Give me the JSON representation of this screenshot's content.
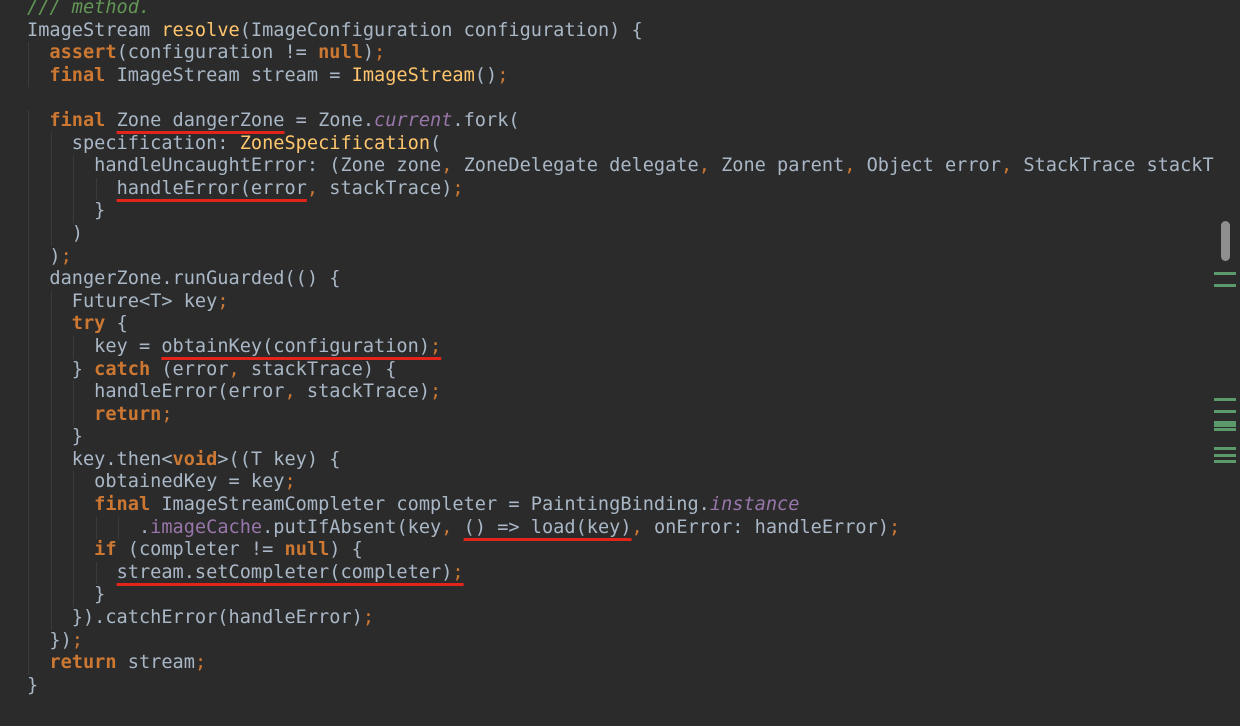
{
  "editor": {
    "colors": {
      "background": "#2b2b2b",
      "plain": "#a9b7c6",
      "keyword": "#cc7832",
      "function": "#ffc66d",
      "comment": "#629755",
      "field": "#9876aa",
      "annotation_underline": "#e3241b",
      "gutter_marker": "#5b9a6b"
    },
    "lines": [
      {
        "indent": 0,
        "tokens": [
          {
            "t": "/// method.",
            "c": "cmt"
          }
        ]
      },
      {
        "indent": 0,
        "tokens": [
          {
            "t": "ImageStream ",
            "c": "plain"
          },
          {
            "t": "resolve",
            "c": "fn"
          },
          {
            "t": "(ImageConfiguration configuration) {",
            "c": "plain"
          }
        ]
      },
      {
        "indent": 1,
        "tokens": [
          {
            "t": "assert",
            "c": "kw"
          },
          {
            "t": "(configuration != ",
            "c": "plain"
          },
          {
            "t": "null",
            "c": "kw"
          },
          {
            "t": ")",
            "c": "plain"
          },
          {
            "t": ";",
            "c": "sym"
          }
        ]
      },
      {
        "indent": 1,
        "tokens": [
          {
            "t": "final ",
            "c": "kw"
          },
          {
            "t": "ImageStream stream = ",
            "c": "plain"
          },
          {
            "t": "ImageStream",
            "c": "fn"
          },
          {
            "t": "()",
            "c": "plain"
          },
          {
            "t": ";",
            "c": "sym"
          }
        ]
      },
      {
        "indent": 0,
        "tokens": []
      },
      {
        "indent": 1,
        "tokens": [
          {
            "t": "final ",
            "c": "kw"
          },
          {
            "t": "Zone dangerZone",
            "c": "plain",
            "u": true
          },
          {
            "t": " = Zone.",
            "c": "plain"
          },
          {
            "t": "current",
            "c": "ital"
          },
          {
            "t": ".fork(",
            "c": "plain"
          }
        ]
      },
      {
        "indent": 2,
        "tokens": [
          {
            "t": "specification: ",
            "c": "plain"
          },
          {
            "t": "ZoneSpecification",
            "c": "fn"
          },
          {
            "t": "(",
            "c": "plain"
          }
        ]
      },
      {
        "indent": 3,
        "tokens": [
          {
            "t": "handleUncaughtError: (Zone zone",
            "c": "plain"
          },
          {
            "t": ", ",
            "c": "sym"
          },
          {
            "t": "ZoneDelegate delegate",
            "c": "plain"
          },
          {
            "t": ", ",
            "c": "sym"
          },
          {
            "t": "Zone parent",
            "c": "plain"
          },
          {
            "t": ", ",
            "c": "sym"
          },
          {
            "t": "Object error",
            "c": "plain"
          },
          {
            "t": ", ",
            "c": "sym"
          },
          {
            "t": "StackTrace stackTr",
            "c": "plain"
          }
        ]
      },
      {
        "indent": 4,
        "tokens": [
          {
            "t": "handleError(error",
            "c": "plain",
            "u": true
          },
          {
            "t": ", ",
            "c": "sym"
          },
          {
            "t": "stackTrace)",
            "c": "plain"
          },
          {
            "t": ";",
            "c": "sym"
          }
        ]
      },
      {
        "indent": 3,
        "tokens": [
          {
            "t": "}",
            "c": "plain"
          }
        ]
      },
      {
        "indent": 2,
        "tokens": [
          {
            "t": ")",
            "c": "plain"
          }
        ]
      },
      {
        "indent": 1,
        "tokens": [
          {
            "t": ")",
            "c": "plain"
          },
          {
            "t": ";",
            "c": "sym"
          }
        ]
      },
      {
        "indent": 1,
        "tokens": [
          {
            "t": "dangerZone.runGuarded(() {",
            "c": "plain"
          }
        ]
      },
      {
        "indent": 2,
        "tokens": [
          {
            "t": "Future<T> key",
            "c": "plain"
          },
          {
            "t": ";",
            "c": "sym"
          }
        ]
      },
      {
        "indent": 2,
        "tokens": [
          {
            "t": "try ",
            "c": "kw"
          },
          {
            "t": "{",
            "c": "plain"
          }
        ]
      },
      {
        "indent": 3,
        "tokens": [
          {
            "t": "key = ",
            "c": "plain"
          },
          {
            "t": "obtainKey(configuration)",
            "c": "plain",
            "u": true
          },
          {
            "t": ";",
            "c": "sym",
            "u": true
          }
        ]
      },
      {
        "indent": 2,
        "tokens": [
          {
            "t": "} ",
            "c": "plain"
          },
          {
            "t": "catch ",
            "c": "kw"
          },
          {
            "t": "(error",
            "c": "plain"
          },
          {
            "t": ", ",
            "c": "sym"
          },
          {
            "t": "stackTrace) {",
            "c": "plain"
          }
        ]
      },
      {
        "indent": 3,
        "tokens": [
          {
            "t": "handleError(error",
            "c": "plain"
          },
          {
            "t": ", ",
            "c": "sym"
          },
          {
            "t": "stackTrace)",
            "c": "plain"
          },
          {
            "t": ";",
            "c": "sym"
          }
        ]
      },
      {
        "indent": 3,
        "tokens": [
          {
            "t": "return",
            "c": "kw"
          },
          {
            "t": ";",
            "c": "sym"
          }
        ]
      },
      {
        "indent": 2,
        "tokens": [
          {
            "t": "}",
            "c": "plain"
          }
        ]
      },
      {
        "indent": 2,
        "tokens": [
          {
            "t": "key.then<",
            "c": "plain"
          },
          {
            "t": "void",
            "c": "kw"
          },
          {
            "t": ">((T key) {",
            "c": "plain"
          }
        ]
      },
      {
        "indent": 3,
        "tokens": [
          {
            "t": "obtainedKey = key",
            "c": "plain"
          },
          {
            "t": ";",
            "c": "sym"
          }
        ]
      },
      {
        "indent": 3,
        "tokens": [
          {
            "t": "final ",
            "c": "kw"
          },
          {
            "t": "ImageStreamCompleter completer = PaintingBinding.",
            "c": "plain"
          },
          {
            "t": "instance",
            "c": "ital"
          }
        ]
      },
      {
        "indent": 5,
        "tokens": [
          {
            "t": ".",
            "c": "plain"
          },
          {
            "t": "imageCache",
            "c": "fld"
          },
          {
            "t": ".putIfAbsent(key",
            "c": "plain"
          },
          {
            "t": ", ",
            "c": "sym"
          },
          {
            "t": "() => load(key)",
            "c": "plain",
            "u": true
          },
          {
            "t": ", ",
            "c": "sym"
          },
          {
            "t": "onError: handleError)",
            "c": "plain"
          },
          {
            "t": ";",
            "c": "sym"
          }
        ]
      },
      {
        "indent": 3,
        "tokens": [
          {
            "t": "if ",
            "c": "kw"
          },
          {
            "t": "(completer != ",
            "c": "plain"
          },
          {
            "t": "null",
            "c": "kw"
          },
          {
            "t": ") {",
            "c": "plain"
          }
        ]
      },
      {
        "indent": 4,
        "tokens": [
          {
            "t": "stream.setCompleter(completer)",
            "c": "plain",
            "u": true
          },
          {
            "t": ";",
            "c": "sym",
            "u": true
          }
        ]
      },
      {
        "indent": 3,
        "tokens": [
          {
            "t": "}",
            "c": "plain"
          }
        ]
      },
      {
        "indent": 2,
        "tokens": [
          {
            "t": "}).catchError(handleError)",
            "c": "plain"
          },
          {
            "t": ";",
            "c": "sym"
          }
        ]
      },
      {
        "indent": 1,
        "tokens": [
          {
            "t": "})",
            "c": "plain"
          },
          {
            "t": ";",
            "c": "sym"
          }
        ]
      },
      {
        "indent": 1,
        "tokens": [
          {
            "t": "return ",
            "c": "kw"
          },
          {
            "t": "stream",
            "c": "plain"
          },
          {
            "t": ";",
            "c": "sym"
          }
        ]
      },
      {
        "indent": 0,
        "tokens": [
          {
            "t": "}",
            "c": "plain"
          }
        ]
      }
    ],
    "gutter_markers": 9
  }
}
